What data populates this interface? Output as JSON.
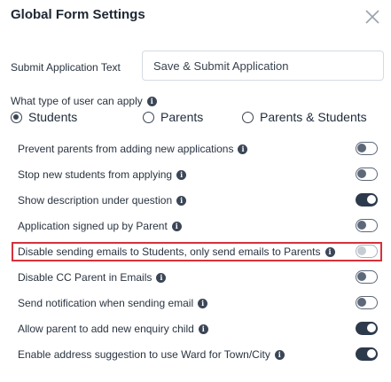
{
  "dialog": {
    "title": "Global Form Settings"
  },
  "submit": {
    "label": "Submit Application Text",
    "value": "Save & Submit Application"
  },
  "user_type": {
    "question": "What type of user can apply",
    "options": [
      "Students",
      "Parents",
      "Parents & Students"
    ],
    "selected": "Students"
  },
  "settings": [
    {
      "label": "Prevent parents from adding new applications",
      "enabled": false
    },
    {
      "label": "Stop new students from applying",
      "enabled": false
    },
    {
      "label": "Show description under question",
      "enabled": true
    },
    {
      "label": "Application signed up by Parent",
      "enabled": false
    },
    {
      "label": "Disable sending emails to Students, only send emails to Parents",
      "enabled": false
    },
    {
      "label": "Disable CC Parent in Emails",
      "enabled": false
    },
    {
      "label": "Send notification when sending email",
      "enabled": false
    },
    {
      "label": "Allow parent to add new enquiry child",
      "enabled": true
    },
    {
      "label": "Enable address suggestion to use Ward for Town/City",
      "enabled": true
    }
  ],
  "colors": {
    "highlight": "#d5313b",
    "toggle_on": "#2d3a4c",
    "text": "#2a3441"
  }
}
